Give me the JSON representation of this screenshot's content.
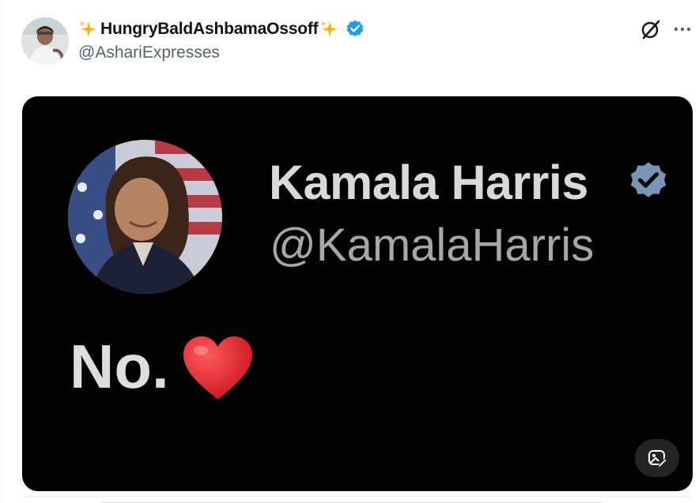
{
  "post": {
    "display_name": "HungryBaldAshbamaOssoff",
    "handle": "@AshariExpresses",
    "verified": true
  },
  "media": {
    "inner_name": "Kamala Harris",
    "inner_handle": "@KamalaHarris",
    "inner_text": "No."
  },
  "icons": {
    "sparkle": "sparkles-icon",
    "verified": "verified-badge-icon",
    "grok": "grok-icon",
    "more": "more-dots-icon",
    "heart": "red-heart-icon",
    "edit": "image-edit-icon"
  },
  "colors": {
    "verified_blue": "#1d9bf0",
    "text_primary": "#0f1419",
    "text_secondary": "#536471",
    "media_bg": "#020202",
    "heart_red": "#e0202a"
  }
}
